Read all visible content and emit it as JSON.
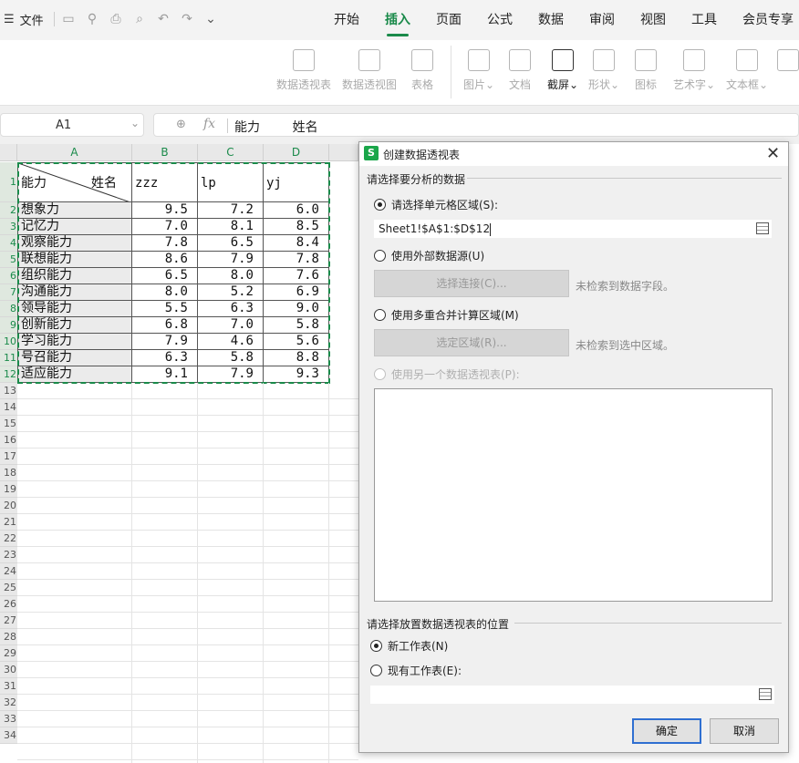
{
  "menubar": {
    "file_label": "文件",
    "tabs": [
      {
        "label": "开始",
        "active": false
      },
      {
        "label": "插入",
        "active": true
      },
      {
        "label": "页面",
        "active": false
      },
      {
        "label": "公式",
        "active": false
      },
      {
        "label": "数据",
        "active": false
      },
      {
        "label": "审阅",
        "active": false
      },
      {
        "label": "视图",
        "active": false
      },
      {
        "label": "工具",
        "active": false
      },
      {
        "label": "会员专享",
        "active": false
      }
    ],
    "accent_color": "#1a8a4a"
  },
  "ribbon": {
    "pivot_table": "数据透视表",
    "pivot_chart": "数据透视图",
    "table": "表格",
    "picture": "图片",
    "document": "文档",
    "screenshot": "截屏",
    "shape": "形状",
    "icon": "图标",
    "wordart": "艺术字",
    "textbox": "文本框"
  },
  "formula_bar": {
    "name_box": "A1",
    "fx": "fx",
    "content": "能力        姓名"
  },
  "sheet": {
    "columns": [
      "A",
      "B",
      "C",
      "D"
    ],
    "header_row": {
      "diag_left": "能力",
      "diag_right": "姓名",
      "b": "zzz",
      "c": "lp",
      "d": "yj"
    },
    "rows": [
      {
        "label": "想象力",
        "b": "9.5",
        "c": "7.2",
        "d": "6.0"
      },
      {
        "label": "记忆力",
        "b": "7.0",
        "c": "8.1",
        "d": "8.5"
      },
      {
        "label": "观察能力",
        "b": "7.8",
        "c": "6.5",
        "d": "8.4"
      },
      {
        "label": "联想能力",
        "b": "8.6",
        "c": "7.9",
        "d": "7.8"
      },
      {
        "label": "组织能力",
        "b": "6.5",
        "c": "8.0",
        "d": "7.6"
      },
      {
        "label": "沟通能力",
        "b": "8.0",
        "c": "5.2",
        "d": "6.9"
      },
      {
        "label": "领导能力",
        "b": "5.5",
        "c": "6.3",
        "d": "9.0"
      },
      {
        "label": "创新能力",
        "b": "6.8",
        "c": "7.0",
        "d": "5.8"
      },
      {
        "label": "学习能力",
        "b": "7.9",
        "c": "4.6",
        "d": "5.6"
      },
      {
        "label": "号召能力",
        "b": "6.3",
        "c": "5.8",
        "d": "8.8"
      },
      {
        "label": "适应能力",
        "b": "9.1",
        "c": "7.9",
        "d": "9.3"
      }
    ],
    "row_numbers": [
      "1",
      "2",
      "3",
      "4",
      "5",
      "6",
      "7",
      "8",
      "9",
      "10",
      "11",
      "12",
      "13",
      "14",
      "15",
      "16",
      "17",
      "18",
      "19",
      "20",
      "21",
      "22",
      "23",
      "24",
      "25",
      "26",
      "27",
      "28",
      "29",
      "30",
      "31",
      "32",
      "33",
      "34"
    ]
  },
  "dialog": {
    "title": "创建数据透视表",
    "logo_letter": "S",
    "section_source": "请选择要分析的数据",
    "opt_range": "请选择单元格区域(S):",
    "range_value": "Sheet1!$A$1:$D$12",
    "opt_external": "使用外部数据源(U)",
    "btn_choose_connection": "选择连接(C)...",
    "hint_no_fields": "未检索到数据字段。",
    "opt_consolidate": "使用多重合并计算区域(M)",
    "btn_select_region": "选定区域(R)...",
    "hint_no_region": "未检索到选中区域。",
    "opt_other_pivot": "使用另一个数据透视表(P):",
    "section_dest": "请选择放置数据透视表的位置",
    "opt_new_sheet": "新工作表(N)",
    "opt_existing_sheet": "现有工作表(E):",
    "existing_value": "",
    "ok_label": "确定",
    "cancel_label": "取消"
  }
}
